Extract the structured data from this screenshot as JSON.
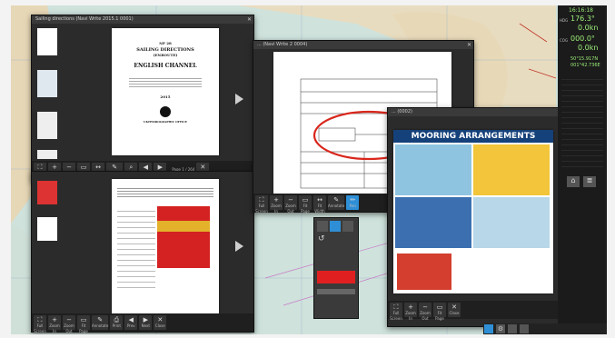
{
  "windows": {
    "main_title": "Sailing directions (Navi Write 2015.1 0001)",
    "doc2_title": "... (Navi Write 2 0004)",
    "doc3_title": "... (0002)"
  },
  "doc1": {
    "np": "NP 28",
    "line1": "SAILING DIRECTIONS",
    "line2": "(ENROUTE)",
    "line3": "ENGLISH CHANNEL",
    "year": "2015",
    "publisher": "UKHYDROGRAPHIC OFFICE"
  },
  "poster": {
    "title": "MOORING ARRANGEMENTS"
  },
  "toolbar": {
    "labels": [
      "Full Screen",
      "Zoom In",
      "Zoom Out",
      "Fit Page",
      "Fit Width",
      "Annotate",
      "Pen",
      "Edit",
      "Search",
      "Print",
      "Prev",
      "Next",
      "Page"
    ],
    "page_indicator": "Page 1 / 264",
    "close": "Close"
  },
  "side": {
    "time": "16:16:18",
    "hdg_label": "HDG",
    "hdg": "176.3°",
    "stw": "0.0kn",
    "cog_label": "COG",
    "cog": "000.0°",
    "sog": "0.0kn",
    "pos_lat": "50°15.917N",
    "pos_lon": "001°42.736E"
  },
  "icons": [
    "close-icon",
    "home-icon",
    "layers-icon",
    "route-icon",
    "gear-icon"
  ]
}
